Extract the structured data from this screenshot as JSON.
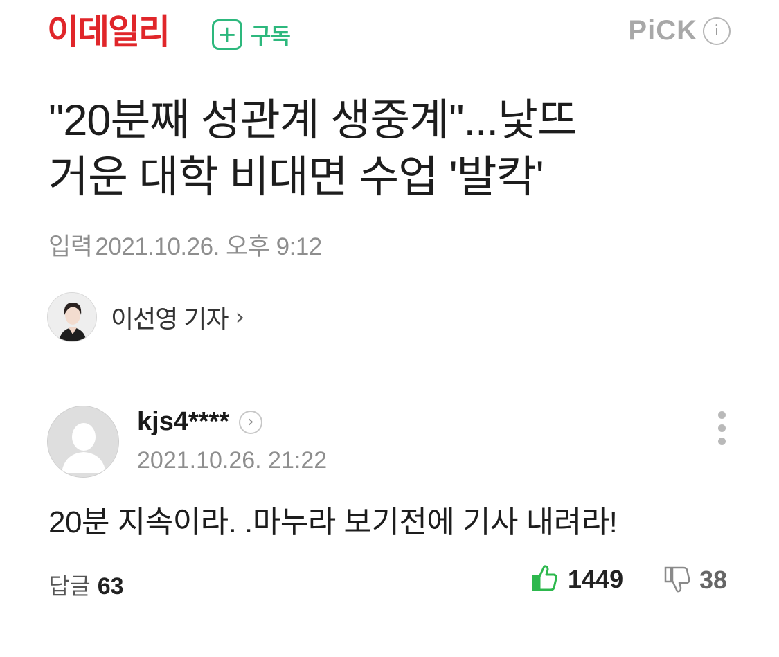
{
  "header": {
    "brand": "이데일리",
    "subscribe_label": "구독",
    "pick_label": "PiCK",
    "colors": {
      "brand": "#e0262a",
      "subscribe": "#2db87d",
      "pick": "#a8a8a8"
    }
  },
  "article": {
    "title_lines": [
      "\"20분째 성관계 생중계\"...낯뜨",
      "거운 대학 비대면 수업 '발칵'"
    ],
    "input_label": "입력",
    "input_datetime": "2021.10.26. 오후 9:12",
    "reporter_name": "이선영 기자",
    "reporter_chevron": "›"
  },
  "comment": {
    "username": "kjs4****",
    "time": "2021.10.26. 21:22",
    "body": "20분 지속이라. .마누라 보기전에 기사 내려라!",
    "replies_label": "답글",
    "replies_count": "63",
    "likes": "1449",
    "dislikes": "38",
    "colors": {
      "like": "#2db84d",
      "dislike": "#8a8a8a"
    }
  }
}
